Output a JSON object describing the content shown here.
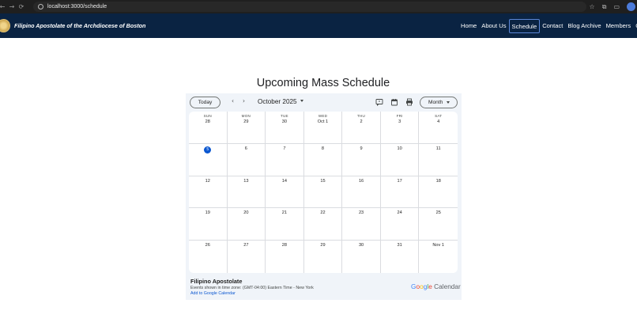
{
  "browser": {
    "url": "localhost:3000/schedule",
    "nav_icons": [
      "←",
      "→",
      "⟳"
    ],
    "right_icons": [
      "☆",
      "⧉",
      "▭"
    ]
  },
  "site": {
    "title": "Filipino Apostolate of the Archdiocese of Boston",
    "nav": [
      {
        "label": "Home",
        "active": false
      },
      {
        "label": "About Us",
        "active": false
      },
      {
        "label": "Schedule",
        "active": true
      },
      {
        "label": "Contact",
        "active": false
      },
      {
        "label": "Blog Archive",
        "active": false
      },
      {
        "label": "Members",
        "active": false
      },
      {
        "label": "Ga",
        "active": false
      }
    ],
    "colors": {
      "navbar": "#0a2342",
      "accent": "#0b57d0"
    }
  },
  "page": {
    "heading": "Upcoming Mass Schedule"
  },
  "calendar": {
    "today_label": "Today",
    "prev_icon": "‹",
    "next_icon": "›",
    "month_label": "October 2025",
    "view_label": "Month",
    "tool_icons": [
      "feedback-icon",
      "calendar-icon",
      "print-icon"
    ],
    "weekdays": [
      "SUN",
      "MON",
      "TUE",
      "WED",
      "THU",
      "FRI",
      "SAT"
    ],
    "weeks": [
      [
        "28",
        "29",
        "30",
        "Oct 1",
        "2",
        "3",
        "4"
      ],
      [
        "5",
        "6",
        "7",
        "8",
        "9",
        "10",
        "11"
      ],
      [
        "12",
        "13",
        "14",
        "15",
        "16",
        "17",
        "18"
      ],
      [
        "19",
        "20",
        "21",
        "22",
        "23",
        "24",
        "25"
      ],
      [
        "26",
        "27",
        "28",
        "29",
        "30",
        "31",
        "Nov 1"
      ]
    ],
    "today": "5",
    "footer": {
      "title": "Filipino Apostolate",
      "timezone": "Events shown in time zone: (GMT-04:00) Eastern Time - New York",
      "add_link": "Add to Google Calendar",
      "brand_google": "Google",
      "brand_calendar": "Calendar"
    }
  }
}
